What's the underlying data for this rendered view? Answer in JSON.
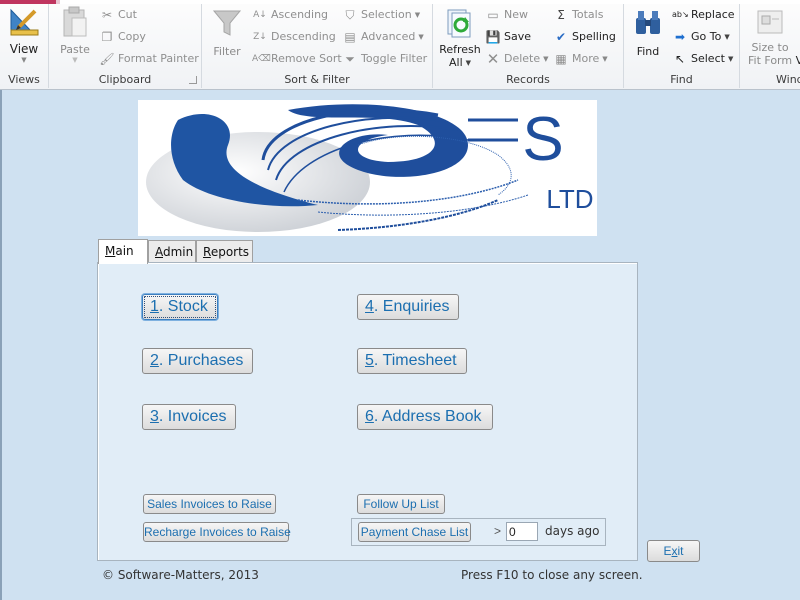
{
  "ribbon": {
    "views": {
      "group_label": "Views",
      "view_label": "View"
    },
    "clipboard": {
      "group_label": "Clipboard",
      "paste": "Paste",
      "cut": "Cut",
      "copy": "Copy",
      "format_painter": "Format Painter"
    },
    "sort_filter": {
      "group_label": "Sort & Filter",
      "filter": "Filter",
      "ascending": "Ascending",
      "descending": "Descending",
      "remove_sort": "Remove Sort",
      "selection": "Selection",
      "advanced": "Advanced",
      "toggle_filter": "Toggle Filter"
    },
    "records": {
      "group_label": "Records",
      "refresh_line1": "Refresh",
      "refresh_line2": "All",
      "new": "New",
      "save": "Save",
      "delete": "Delete",
      "totals": "Totals",
      "spelling": "Spelling",
      "more": "More"
    },
    "find": {
      "group_label": "Find",
      "find": "Find",
      "replace": "Replace",
      "goto": "Go To",
      "select": "Select"
    },
    "window": {
      "group_label": "Wind",
      "size_line1": "Size to",
      "size_line2": "Fit Form",
      "switch_partial": "V"
    }
  },
  "logo": {
    "text": "ES",
    "subtext": "LTD",
    "brand_color": "#1f4e9c"
  },
  "tabs": [
    {
      "accel": "M",
      "rest": "ain",
      "label": "Main"
    },
    {
      "accel": "A",
      "rest": "dmin",
      "label": "Admin"
    },
    {
      "accel": "R",
      "rest": "eports",
      "label": "Reports"
    }
  ],
  "main_buttons": [
    {
      "accel": "1",
      "rest": ". Stock"
    },
    {
      "accel": "2",
      "rest": ". Purchases"
    },
    {
      "accel": "3",
      "rest": ". Invoices"
    },
    {
      "accel": "4",
      "rest": ". Enquiries"
    },
    {
      "accel": "5",
      "rest": ". Timesheet"
    },
    {
      "accel": "6",
      "rest": ". Address Book"
    }
  ],
  "small_buttons": {
    "sales_invoices": "Sales Invoices to Raise",
    "recharge_invoices": "Recharge Invoices to Raise",
    "follow_up": "Follow Up List",
    "payment_chase": "Payment Chase List"
  },
  "payment_chase": {
    "operator": ">",
    "days_value": "0",
    "days_label": "days ago"
  },
  "exit": {
    "pre": "E",
    "accel": "x",
    "post": "it"
  },
  "footer": {
    "copyright": "© Software-Matters, 2013",
    "hint": "Press F10 to close any screen."
  }
}
